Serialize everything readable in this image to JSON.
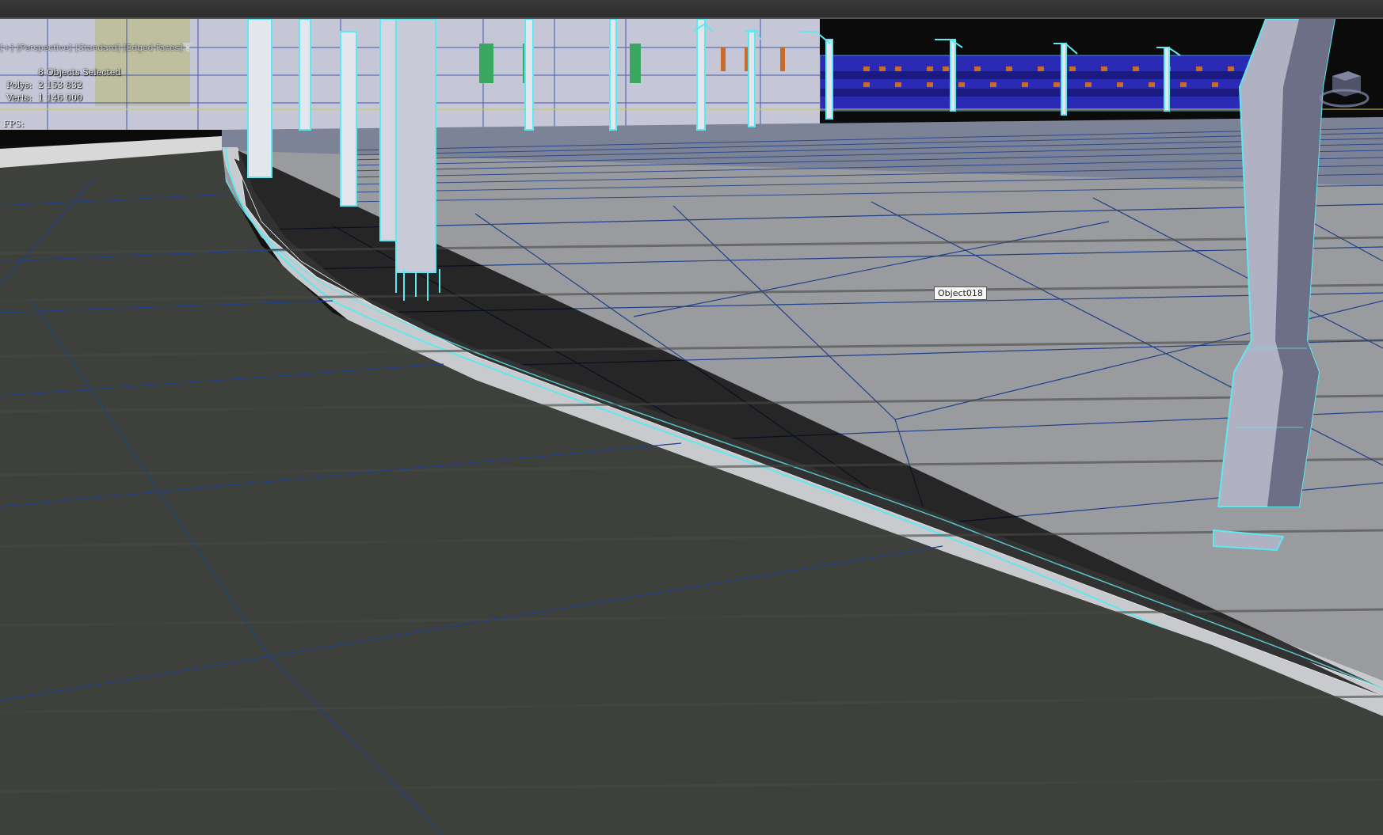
{
  "viewport": {
    "label_plus": "[+]",
    "label_view": "[Perspective]",
    "label_shading": "[Standard]",
    "label_faces": "[Edged Faces]"
  },
  "stats": {
    "selection": "8 Objects Selected",
    "polys_label": "Polys:",
    "polys_value": "2 153 832",
    "verts_label": "Verts:",
    "verts_value": "1 146 000",
    "fps_label": "FPS:"
  },
  "tooltip": {
    "text": "Object018"
  },
  "icons": {
    "filter": "filter-icon",
    "viewcube": "viewcube-icon",
    "axis": "axis-tripod-icon"
  },
  "colors": {
    "selection": "#5ee8f0",
    "wire": "#1e3f8a",
    "road": "#3e403c",
    "sidewalk": "#9a9b9e",
    "building_blue": "#2a2ab4",
    "sky": "#0b0b0b"
  }
}
